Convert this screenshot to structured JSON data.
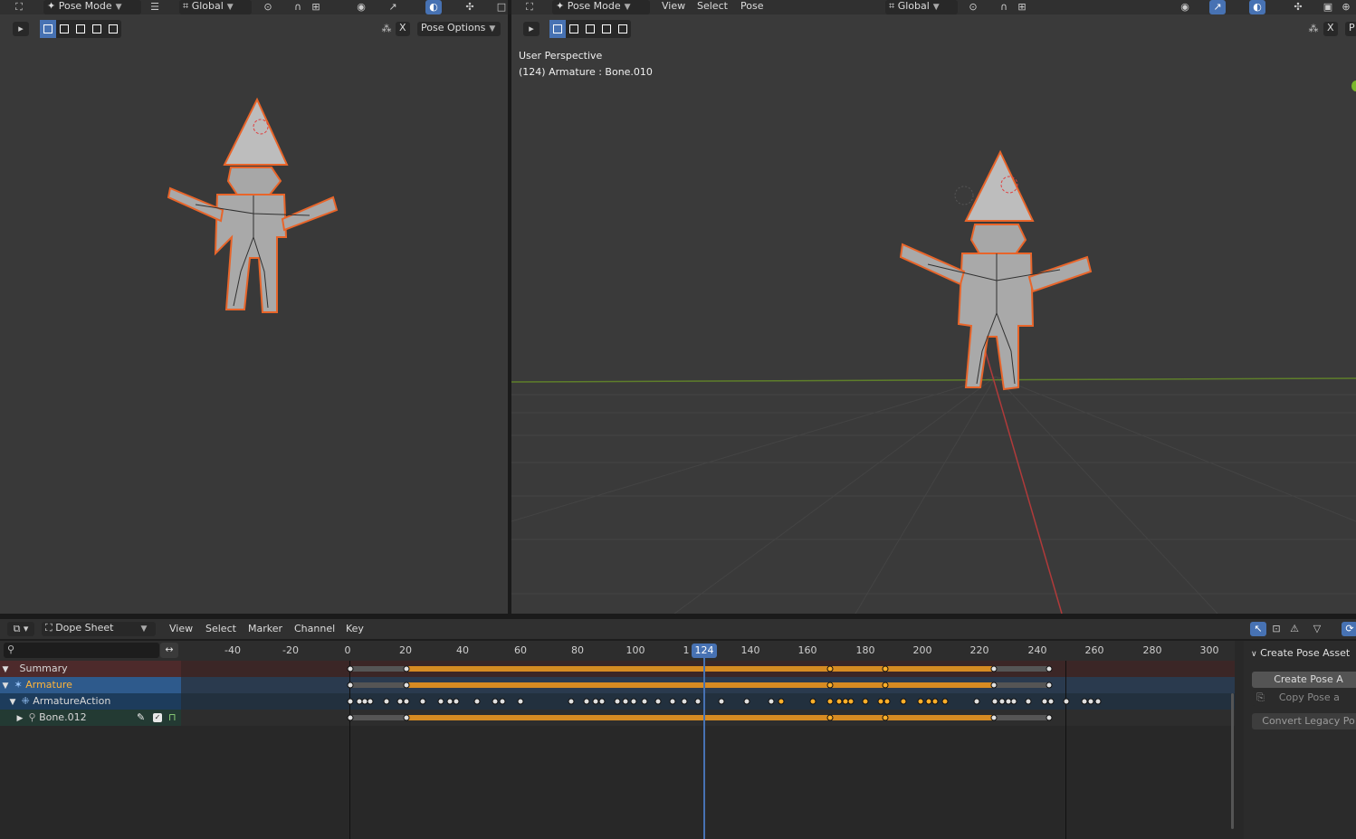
{
  "left_viewport": {
    "mode": "Pose Mode",
    "transform": "Global",
    "pose_options": "Pose Options",
    "x_label": "X"
  },
  "right_viewport": {
    "mode": "Pose Mode",
    "menus": [
      "View",
      "Select",
      "Pose"
    ],
    "transform": "Global",
    "x_label": "X",
    "p_label": "P",
    "overlay_line1": "User Perspective",
    "overlay_line2": "(124) Armature : Bone.010"
  },
  "dopesheet": {
    "editor": "Dope Sheet",
    "menus": [
      "View",
      "Select",
      "Marker",
      "Channel",
      "Key"
    ],
    "current_frame": "124",
    "partial_frame": "1",
    "ticks": [
      "-40",
      "-20",
      "0",
      "20",
      "40",
      "60",
      "80",
      "100",
      "140",
      "160",
      "180",
      "200",
      "220",
      "240",
      "260",
      "280",
      "300"
    ],
    "channels": {
      "summary": "Summary",
      "armature": "Armature",
      "action": "ArmatureAction",
      "bone": "Bone.012"
    },
    "sidebar": {
      "header": "Create Pose Asset",
      "create": "Create Pose A",
      "copy": "Copy Pose a",
      "convert": "Convert Legacy Po"
    }
  },
  "colors": {
    "selected_key": "#ffaf29",
    "hold_bar": "#d78b22",
    "playhead": "#4772b3",
    "summary_row": "#4d2a2b",
    "armature_row": "#2e5a8c",
    "action_row": "#1d3c5c",
    "bone_row": "#233a33"
  },
  "icons": {
    "search": "search-icon",
    "swap": "swap-icon",
    "armature": "armature-icon",
    "action": "action-icon",
    "bone": "bone-icon",
    "wrench": "wrench-icon",
    "check": "checkbox-icon",
    "lock": "lock-icon"
  }
}
